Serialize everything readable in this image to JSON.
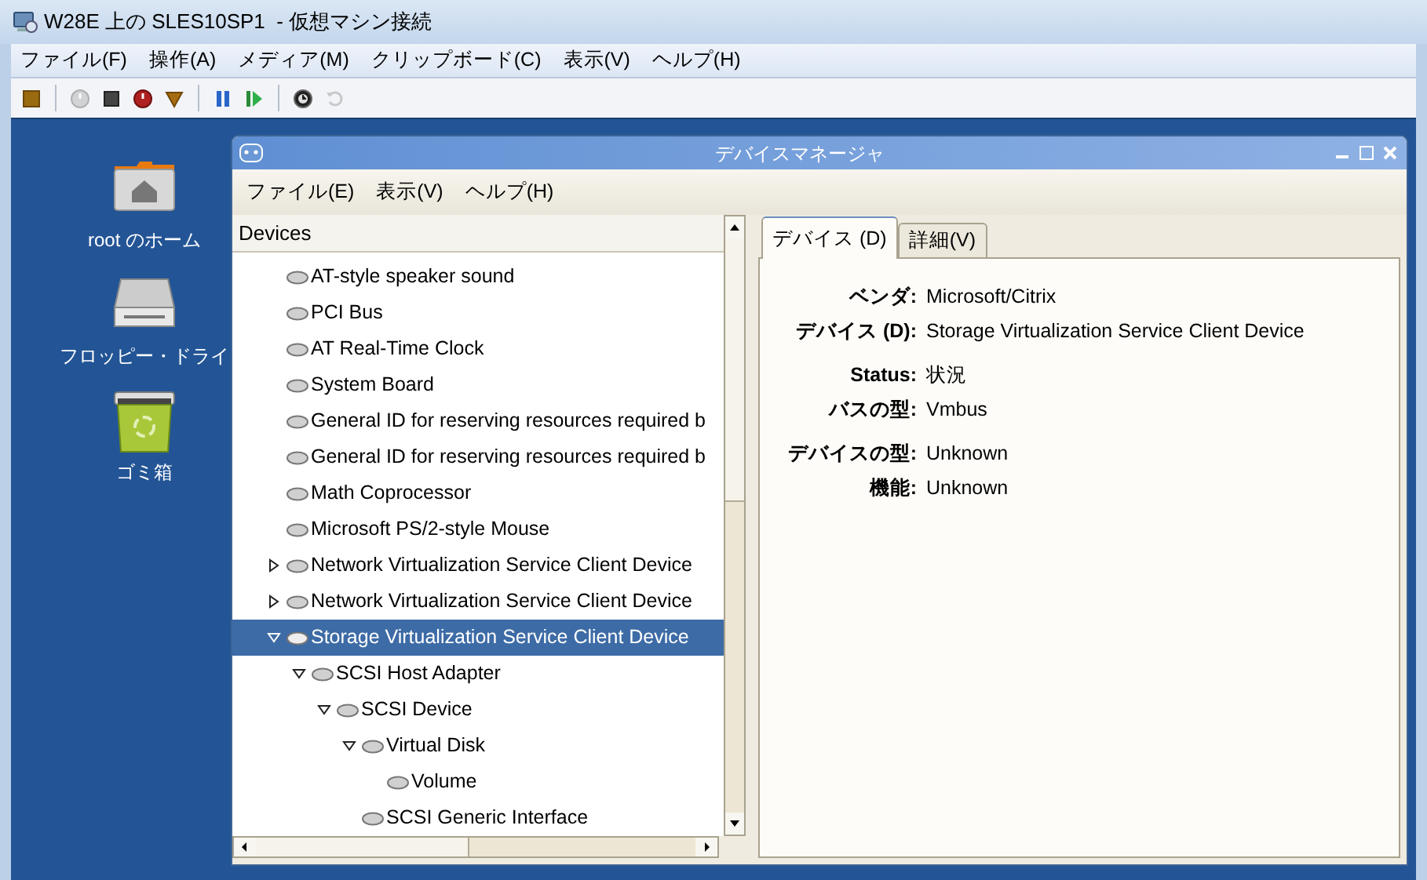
{
  "host_window": {
    "title": "W28E 上の SLES10SP1  - 仮想マシン接続",
    "menu": [
      "ファイル(F)",
      "操作(A)",
      "メディア(M)",
      "クリップボード(C)",
      "表示(V)",
      "ヘルプ(H)"
    ],
    "toolbar": [
      {
        "kind": "ctrl-alt-del"
      },
      {
        "kind": "separator"
      },
      {
        "kind": "start",
        "disabled": true
      },
      {
        "kind": "stop"
      },
      {
        "kind": "shutdown"
      },
      {
        "kind": "save"
      },
      {
        "kind": "separator"
      },
      {
        "kind": "pause"
      },
      {
        "kind": "resume"
      },
      {
        "kind": "separator"
      },
      {
        "kind": "snapshot"
      },
      {
        "kind": "revert",
        "disabled": true
      }
    ]
  },
  "desktop_icons": [
    {
      "kind": "home",
      "label": "root のホーム"
    },
    {
      "kind": "floppy",
      "label": "フロッピー・ドライ"
    },
    {
      "kind": "trash",
      "label": "ゴミ箱"
    }
  ],
  "device_manager": {
    "title": "デバイスマネージャ",
    "menu": [
      "ファイル(E)",
      "表示(V)",
      "ヘルプ(H)"
    ],
    "tree": {
      "header": "Devices",
      "items": [
        {
          "label": "AT-style speaker sound",
          "selected": false
        },
        {
          "label": "PCI Bus",
          "selected": false
        },
        {
          "label": "AT Real-Time Clock",
          "selected": false
        },
        {
          "label": "System Board",
          "selected": false
        },
        {
          "label": "General ID for reserving resources required b",
          "selected": false
        },
        {
          "label": "General ID for reserving resources required b",
          "selected": false
        },
        {
          "label": "Math Coprocessor",
          "selected": false
        },
        {
          "label": "Microsoft PS/2-style Mouse",
          "selected": false
        },
        {
          "label": "Network Virtualization Service Client Device",
          "selected": false,
          "expanded": false
        },
        {
          "label": "Network Virtualization Service Client Device",
          "selected": false,
          "expanded": false
        },
        {
          "label": "Storage Virtualization Service Client Device",
          "selected": true,
          "expanded": true,
          "children": [
            {
              "label": "SCSI Host Adapter",
              "selected": false,
              "expanded": true,
              "children": [
                {
                  "label": "SCSI Device",
                  "selected": false,
                  "expanded": true,
                  "children": [
                    {
                      "label": "Virtual Disk",
                      "selected": false,
                      "expanded": true,
                      "children": [
                        {
                          "label": "Volume",
                          "selected": false
                        }
                      ]
                    },
                    {
                      "label": "SCSI Generic Interface",
                      "selected": false
                    }
                  ]
                }
              ]
            }
          ]
        }
      ]
    },
    "tabs": [
      {
        "label": "デバイス (D)",
        "selected": true
      },
      {
        "label": "詳細(V)",
        "selected": false
      }
    ],
    "properties": [
      {
        "label": "ベンダ:",
        "value": "Microsoft/Citrix"
      },
      {
        "label": "デバイス (D):",
        "value": "Storage Virtualization Service Client Device"
      },
      {
        "label": "Status:",
        "value": "状況"
      },
      {
        "label": "バスの型:",
        "value": "Vmbus"
      },
      {
        "label": "デバイスの型:",
        "value": "Unknown"
      },
      {
        "label": "機能:",
        "value": "Unknown"
      }
    ]
  }
}
